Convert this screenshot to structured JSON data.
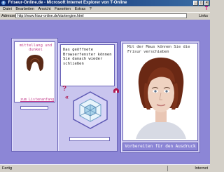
{
  "window": {
    "title": "Friseur-Online.de - Microsoft Internet Explorer von T-Online"
  },
  "menu": {
    "items": [
      "Datei",
      "Bearbeiten",
      "Ansicht",
      "Favoriten",
      "Extras",
      "?"
    ],
    "brand": "T"
  },
  "address": {
    "label": "Adresse",
    "url": "http://www.frisur-online.de/startengine.html",
    "links": "Links"
  },
  "content": {
    "hair_label": "mittellang und dunkel",
    "back_link": "zum Listenanfang",
    "message": "Das geöffnete Browserfenster können Sie danach wieder schließen",
    "help_icon": "?",
    "back_icon": "«",
    "caption": "Mit der Maus können Sie die Frisur verschieben",
    "print_button": "Vorbereiten für den Ausdruck"
  },
  "status": {
    "left": "Fertig",
    "right": "Internet"
  }
}
